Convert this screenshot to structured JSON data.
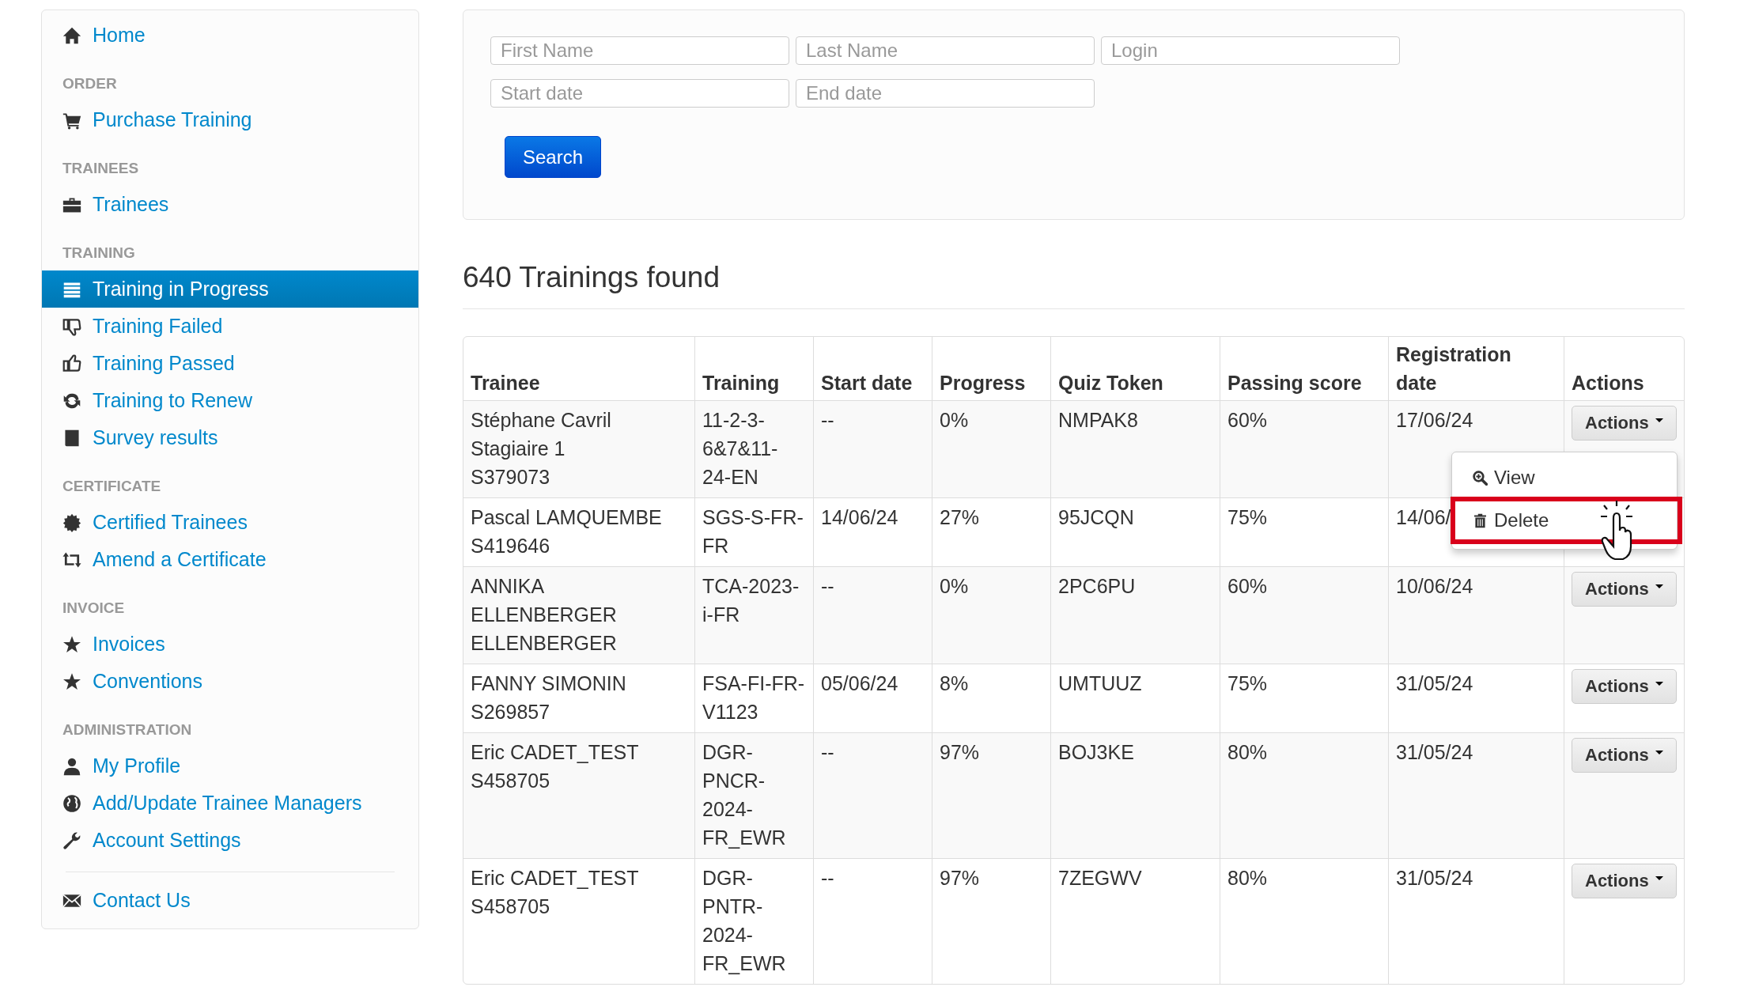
{
  "sidebar": {
    "sections": [
      {
        "items": [
          {
            "label": "Home",
            "selected": false
          }
        ]
      },
      {
        "heading": "ORDER",
        "items": [
          {
            "label": "Purchase Training",
            "selected": false
          }
        ]
      },
      {
        "heading": "TRAINEES",
        "items": [
          {
            "label": "Trainees",
            "selected": false
          }
        ]
      },
      {
        "heading": "TRAINING",
        "items": [
          {
            "label": "Training in Progress",
            "selected": true
          },
          {
            "label": "Training Failed",
            "selected": false
          },
          {
            "label": "Training Passed",
            "selected": false
          },
          {
            "label": "Training to Renew",
            "selected": false
          },
          {
            "label": "Survey results",
            "selected": false
          }
        ]
      },
      {
        "heading": "CERTIFICATE",
        "items": [
          {
            "label": "Certified Trainees",
            "selected": false
          },
          {
            "label": "Amend a Certificate",
            "selected": false
          }
        ]
      },
      {
        "heading": "INVOICE",
        "items": [
          {
            "label": "Invoices",
            "selected": false
          },
          {
            "label": "Conventions",
            "selected": false
          }
        ]
      },
      {
        "heading": "ADMINISTRATION",
        "items": [
          {
            "label": "My Profile",
            "selected": false
          },
          {
            "label": "Add/Update Trainee Managers",
            "selected": false
          },
          {
            "label": "Account Settings",
            "selected": false
          }
        ]
      },
      {
        "items": [
          {
            "label": "Contact Us",
            "selected": false
          }
        ]
      }
    ]
  },
  "search_form": {
    "fields": [
      {
        "placeholder": "First Name"
      },
      {
        "placeholder": "Last Name"
      },
      {
        "placeholder": "Login"
      },
      {
        "placeholder": "Start date"
      },
      {
        "placeholder": "End date"
      }
    ],
    "button": "Search"
  },
  "results_heading": "640 Trainings found",
  "table": {
    "columns": [
      "Trainee",
      "Training",
      "Start date",
      "Progress",
      "Quiz Token",
      "Passing score",
      "Registration date",
      "Actions"
    ],
    "rows": [
      {
        "trainee": "Stéphane Cavril Stagiaire 1",
        "trainee_id": "S379073",
        "training": "11-2-3-6&7&11-24-EN",
        "start_date": "--",
        "progress": "0%",
        "quiz_token": "NMPAK8",
        "passing_score": "60%",
        "registration_date": "17/06/24",
        "actions": "Actions",
        "menu_open": true
      },
      {
        "trainee": "Pascal LAMQUEMBE",
        "trainee_id": "S419646",
        "training": "SGS-S-FR-FR",
        "start_date": "14/06/24",
        "progress": "27%",
        "quiz_token": "95JCQN",
        "passing_score": "75%",
        "registration_date": "14/06/",
        "menu_open": false
      },
      {
        "trainee": "ANNIKA ELLENBERGER ELLENBERGER",
        "training": "TCA-2023-i-FR",
        "start_date": "--",
        "progress": "0%",
        "quiz_token": "2PC6PU",
        "passing_score": "60%",
        "registration_date": "10/06/24",
        "actions": "Actions",
        "menu_open": false
      },
      {
        "trainee": "FANNY SIMONIN",
        "trainee_id": "S269857",
        "training": "FSA-FI-FR-V1123",
        "start_date": "05/06/24",
        "progress": "8%",
        "quiz_token": "UMTUUZ",
        "passing_score": "75%",
        "registration_date": "31/05/24",
        "actions": "Actions",
        "menu_open": false
      },
      {
        "trainee": "Eric CADET_TEST",
        "trainee_id": "S458705",
        "training": "DGR-PNCR-2024-FR_EWR",
        "start_date": "--",
        "progress": "97%",
        "quiz_token": "BOJ3KE",
        "passing_score": "80%",
        "registration_date": "31/05/24",
        "actions": "Actions",
        "menu_open": false
      },
      {
        "trainee": "Eric CADET_TEST",
        "trainee_id": "S458705",
        "training": "DGR-PNTR-2024-FR_EWR",
        "start_date": "--",
        "progress": "97%",
        "quiz_token": "7ZEGWV",
        "passing_score": "80%",
        "registration_date": "31/05/24",
        "actions": "Actions",
        "menu_open": false
      }
    ]
  },
  "actions_menu": {
    "items": [
      {
        "label": "View",
        "highlighted": false
      },
      {
        "label": "Delete",
        "highlighted": true
      }
    ]
  }
}
